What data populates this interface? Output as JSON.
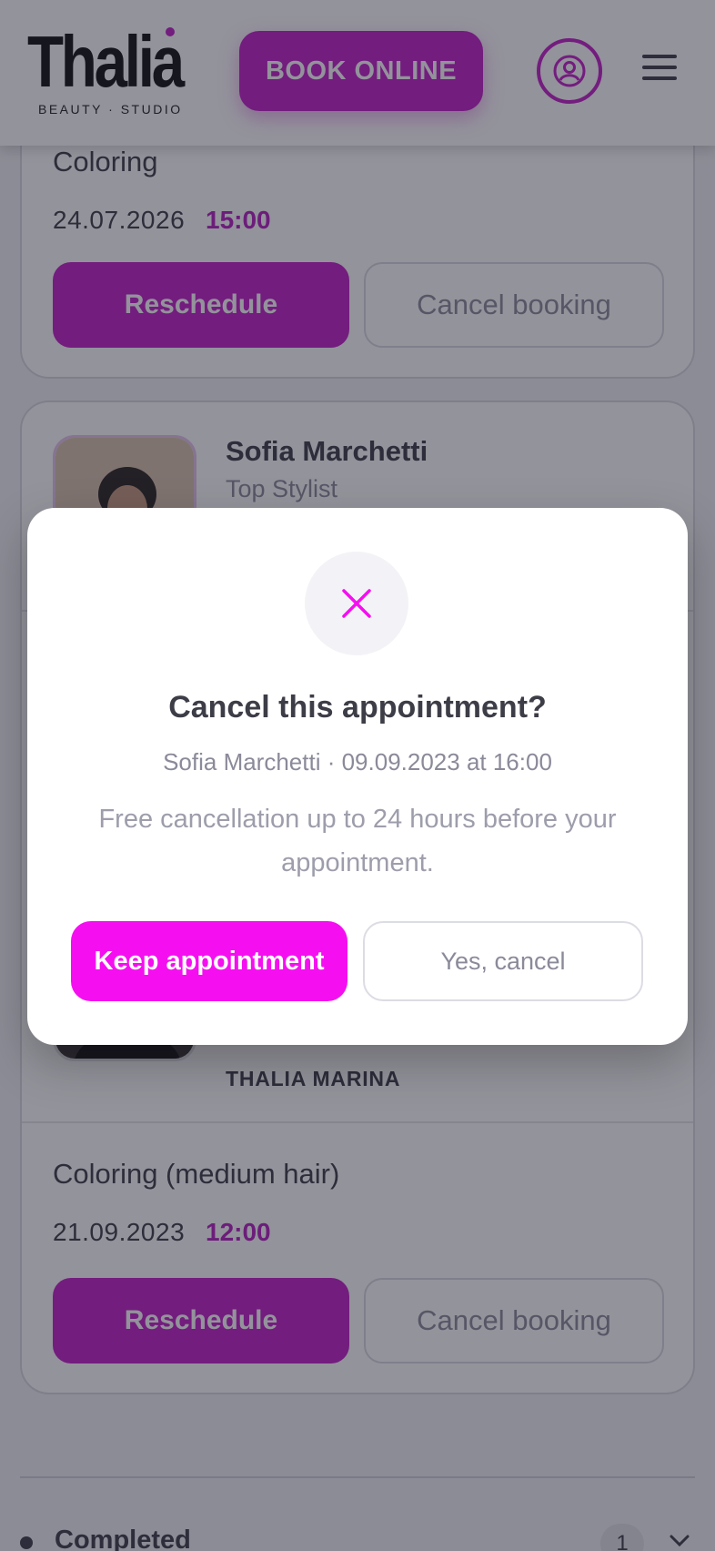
{
  "header": {
    "logo_text": "Thalia",
    "logo_subtitle": "BEAUTY · STUDIO",
    "book_label": "BOOK ONLINE",
    "profile_icon": "user-circle-icon",
    "menu_icon": "hamburger-menu-icon"
  },
  "bookings": [
    {
      "service": "Coloring",
      "date": "24.07.2026",
      "time": "15:00",
      "reschedule_label": "Reschedule",
      "cancel_label": "Cancel booking"
    },
    {
      "stylist_name": "Sofia Marchetti",
      "stylist_role": "Top Stylist",
      "salon": "THALIA MARINA",
      "service": "Coloring (medium hair)",
      "date": "21.09.2023",
      "time": "12:00",
      "reschedule_label": "Reschedule",
      "cancel_label": "Cancel booking"
    }
  ],
  "completed": {
    "label": "Completed",
    "count": "1"
  },
  "dialog": {
    "title": "Cancel this appointment?",
    "subtitle": "Sofia Marchetti · 09.09.2023 at 16:00",
    "note": "Free cancellation up to 24 hours before your appointment.",
    "keep_label": "Keep appointment",
    "confirm_label": "Yes, cancel"
  },
  "colors": {
    "brand": "#c21ec7",
    "keep_button": "#f50ff0",
    "overlay": "rgba(30,30,45,0.48)"
  }
}
